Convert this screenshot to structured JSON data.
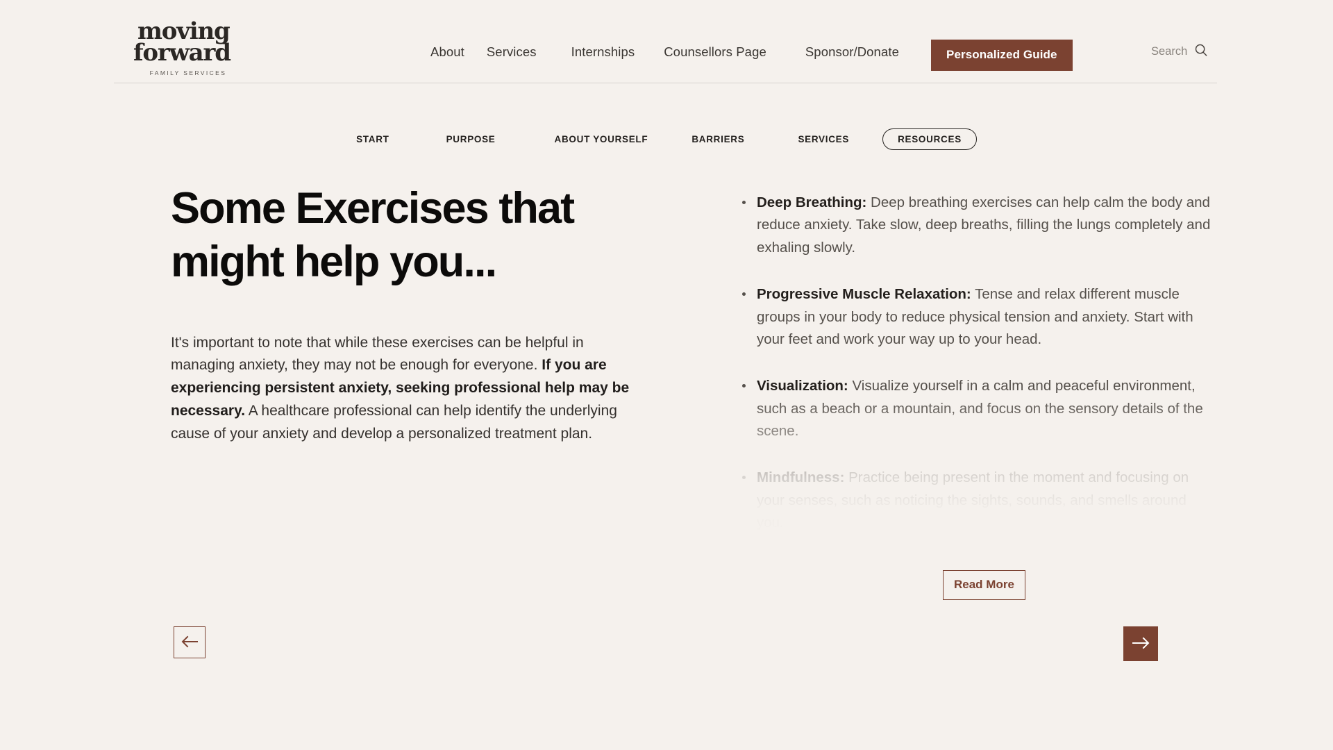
{
  "colors": {
    "background": "#F5F1ED",
    "brand_brown": "#7B4231",
    "text_dark": "#0C0B0A",
    "text_body": "#35312E",
    "text_muted": "#8A847E",
    "rule": "#D6D2CE"
  },
  "header": {
    "logo": {
      "line1": "moving",
      "line2": "forward",
      "tagline": "FAMILY SERVICES"
    },
    "nav": [
      {
        "label": "About"
      },
      {
        "label": "Services"
      },
      {
        "label": "Internships"
      },
      {
        "label": "Counsellors Page"
      },
      {
        "label": "Sponsor/Donate"
      }
    ],
    "cta_label": "Personalized Guide",
    "search": {
      "label": "Search",
      "icon": "search-icon"
    }
  },
  "steps": {
    "items": [
      {
        "label": "START",
        "active": false
      },
      {
        "label": "PURPOSE",
        "active": false
      },
      {
        "label": "ABOUT YOURSELF",
        "active": false
      },
      {
        "label": "BARRIERS",
        "active": false
      },
      {
        "label": "SERVICES",
        "active": false
      },
      {
        "label": "RESOURCES",
        "active": true
      }
    ]
  },
  "main": {
    "headline": "Some Exercises that might help you...",
    "body": {
      "part1": "It's important to note that while these exercises can be helpful in managing anxiety, they may not be enough for everyone. ",
      "bold": "If you are experiencing persistent anxiety, seeking professional help may be necessary.",
      "part2": " A healthcare professional can help identify the underlying cause of your anxiety and develop a personalized treatment plan."
    },
    "tips": [
      {
        "term": "Deep Breathing:",
        "text": " Deep breathing exercises can help calm the body and reduce anxiety. Take slow, deep breaths, filling the lungs completely and exhaling slowly."
      },
      {
        "term": "Progressive Muscle Relaxation:",
        "text": " Tense and relax different muscle groups in your body to reduce physical tension and anxiety. Start with your feet and work your way up to your head."
      },
      {
        "term": "Visualization:",
        "text": " Visualize yourself in a calm and peaceful environment, such as a beach or a mountain, and focus on the sensory details of the scene."
      },
      {
        "term": "Mindfulness:",
        "text": " Practice being present in the moment and focusing on your senses, such as noticing the sights, sounds, and smells around you."
      }
    ],
    "read_more_label": "Read More"
  },
  "pager": {
    "prev_icon": "arrow-left-icon",
    "next_icon": "arrow-right-icon"
  }
}
